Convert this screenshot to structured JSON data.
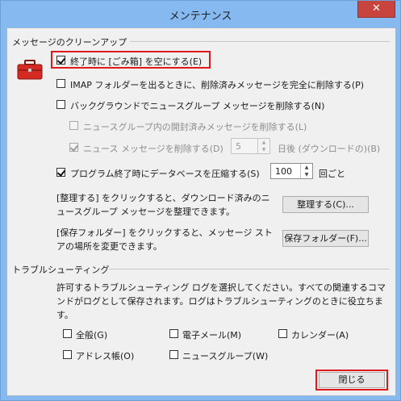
{
  "window": {
    "title": "メンテナンス",
    "close_label": "✕"
  },
  "cleanup": {
    "label": "メッセージのクリーンアップ",
    "empty_trash": "終了時に [ごみ箱] を空にする(E)",
    "imap_purge": "IMAP フォルダーを出るときに、削除済みメッセージを完全に削除する(P)",
    "bg_delete_news": "バックグラウンドでニュースグループ メッセージを削除する(N)",
    "delete_read_news": "ニュースグループ内の開封済みメッセージを削除する(L)",
    "delete_news_after": "ニュース メッセージを削除する(D)",
    "days_value": "5",
    "days_suffix": "日後 (ダウンロードの)(B)",
    "compact_db": "プログラム終了時にデータベースを圧縮する(S)",
    "compact_value": "100",
    "compact_suffix": "回ごと",
    "cleanup_text": "[整理する] をクリックすると、ダウンロード済みのニュースグループ メッセージを整理できます。",
    "cleanup_button": "整理する(C)...",
    "store_text": "[保存フォルダー] をクリックすると、メッセージ ストアの場所を変更できます。",
    "store_button": "保存フォルダー(F)..."
  },
  "troubleshooting": {
    "label": "トラブルシューティング",
    "description": "許可するトラブルシューティング ログを選択してください。すべての関連するコマンドがログとして保存されます。ログはトラブルシューティングのときに役立ちます。",
    "general": "全般(G)",
    "mail": "電子メール(M)",
    "calendar": "カレンダー(A)",
    "contacts": "アドレス帳(O)",
    "news": "ニュースグループ(W)"
  },
  "footer": {
    "close_button": "閉じる"
  },
  "colors": {
    "highlight": "#e0191b",
    "titlebar": "#85b9ef",
    "close": "#c7453e"
  }
}
